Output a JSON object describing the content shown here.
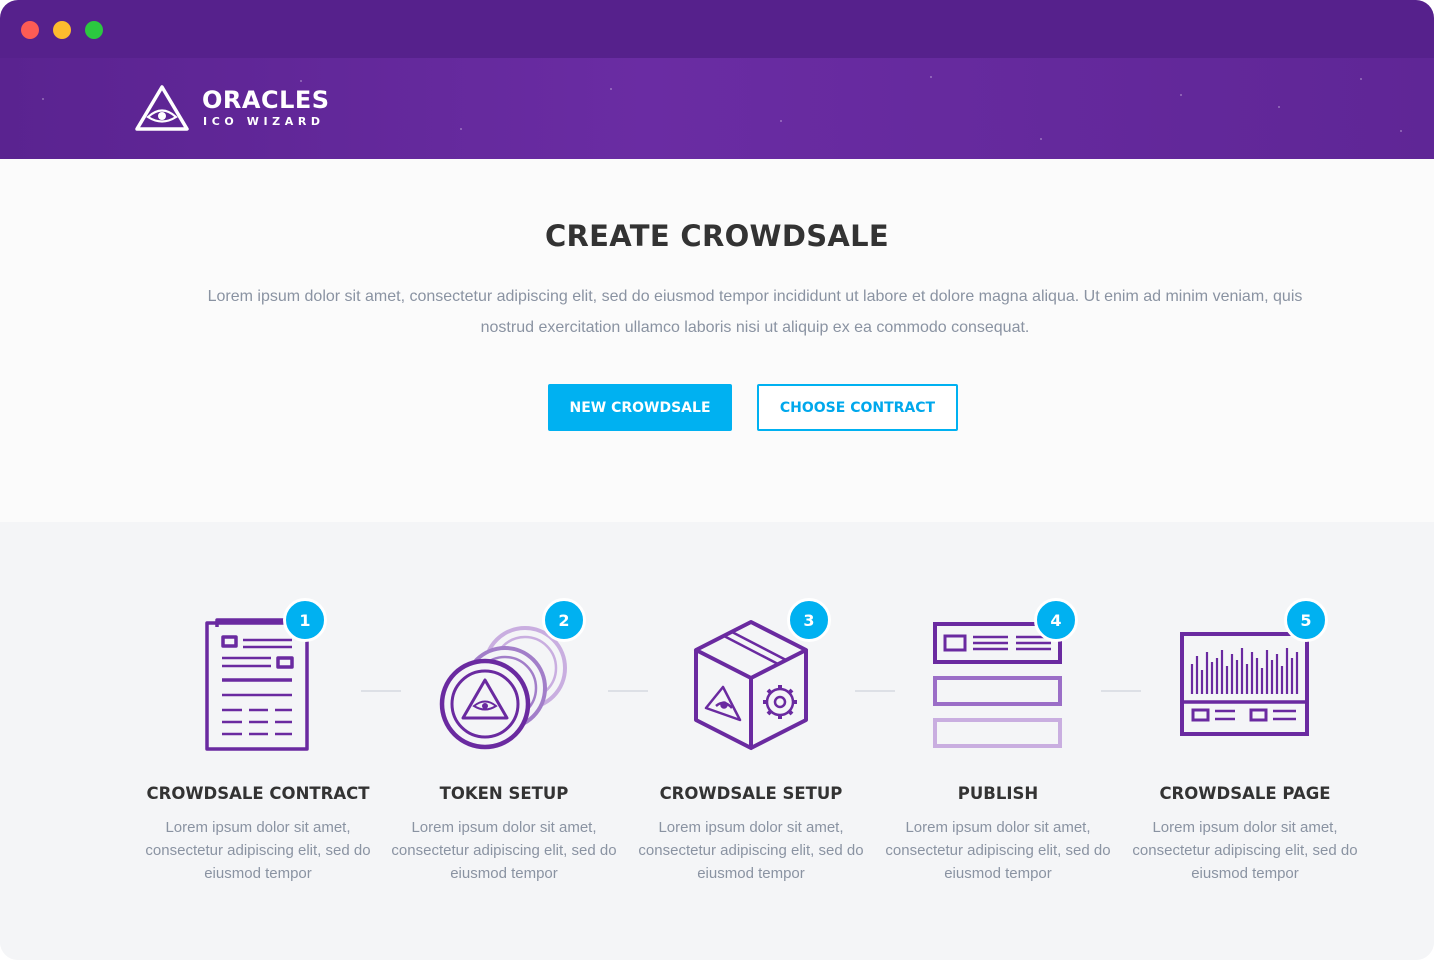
{
  "window": {
    "controls": [
      "close",
      "minimize",
      "maximize"
    ],
    "colors": {
      "close": "#fc5c55",
      "minimize": "#fdbb2e",
      "maximize": "#2bc840"
    }
  },
  "header": {
    "brand_name": "ORACLES",
    "brand_sub": "ICO WIZARD",
    "logo_icon": "eye-triangle-icon",
    "color": "#5a2390"
  },
  "hero": {
    "title": "CREATE CROWDSALE",
    "description": "Lorem ipsum dolor sit amet, consectetur adipiscing elit, sed do eiusmod tempor incididunt ut labore et dolore magna aliqua. Ut enim ad minim veniam, quis nostrud exercitation ullamco laboris nisi ut aliquip ex ea  commodo consequat.",
    "primary_button": "NEW CROWDSALE",
    "secondary_button": "CHOOSE CONTRACT",
    "accent": "#00b1f1"
  },
  "steps": [
    {
      "number": "1",
      "title": "CROWDSALE CONTRACT",
      "text": "Lorem ipsum dolor sit amet, consectetur adipiscing elit, sed do eiusmod tempor",
      "icon": "contract-document-icon"
    },
    {
      "number": "2",
      "title": "TOKEN SETUP",
      "text": "Lorem ipsum dolor sit amet, consectetur adipiscing elit, sed do eiusmod tempor",
      "icon": "token-coins-icon"
    },
    {
      "number": "3",
      "title": "CROWDSALE SETUP",
      "text": "Lorem ipsum dolor sit amet, consectetur adipiscing elit, sed do eiusmod tempor",
      "icon": "box-gear-icon"
    },
    {
      "number": "4",
      "title": "PUBLISH",
      "text": "Lorem ipsum dolor sit amet, consectetur adipiscing elit, sed do eiusmod tempor",
      "icon": "publish-stack-icon"
    },
    {
      "number": "5",
      "title": "CROWDSALE PAGE",
      "text": "Lorem ipsum dolor sit amet, consectetur adipiscing elit, sed do eiusmod tempor",
      "icon": "crowdsale-page-chart-icon"
    }
  ],
  "icon_color": "#6a2aa0"
}
